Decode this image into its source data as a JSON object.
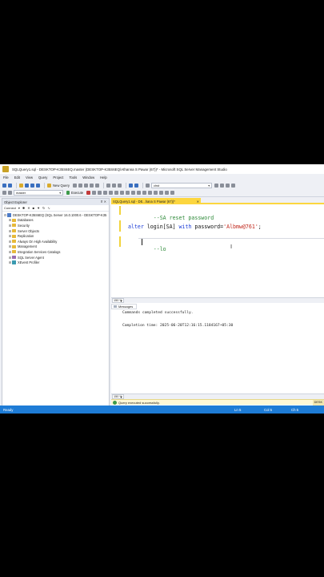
{
  "window": {
    "title": "SQLQuery1.sql - DESKTOP-K35S6EQ.master (DESKTOP-K35S6EQ\\Athanna S Pawar (67))* - Microsoft SQL Server Management Studio"
  },
  "menu": [
    "File",
    "Edit",
    "View",
    "Query",
    "Project",
    "Tools",
    "Window",
    "Help"
  ],
  "toolbar": {
    "new_query_label": "New Query",
    "db_combo_value": "master",
    "execute_label": "Execute",
    "search_combo_value": "chst"
  },
  "object_explorer": {
    "title": "Object Explorer",
    "connect_label": "Connect",
    "server_node": "DESKTOP-K35S6EQ (SQL Server 16.0.1000.6 - DESKTOP-K35",
    "nodes": [
      "Databases",
      "Security",
      "Server Objects",
      "Replication",
      "Always On High Availability",
      "Management",
      "Integration Services Catalogs",
      "SQL Server Agent",
      "XEvent Profiler"
    ]
  },
  "editor": {
    "tab_label": "SQLQuery1.sql - DE...hana S Pawar (67))*",
    "lines": {
      "comment1": "--SA reset password",
      "alter_kw1": "alter",
      "alter_text1": " login[SA] ",
      "alter_kw2": "with",
      "alter_text2": " password=",
      "alter_string": "'Albmw@761'",
      "alter_end": ";",
      "comment2": "--lo"
    },
    "zoom": "150 %"
  },
  "results": {
    "tab_label": "Messages",
    "line1": "Commands completed successfully.",
    "line2": "Completion time: 2025-06-20T12:16:15.1184167+05:30",
    "zoom": "150 %"
  },
  "query_status": {
    "text": "Query executed successfully.",
    "server": "DESK"
  },
  "statusbar": {
    "ready": "Ready",
    "ln": "Ln 5",
    "col": "Col 5",
    "ch": "Ch 5"
  },
  "colors": {
    "accent": "#1e7cd6",
    "tab_active": "#fcd63f",
    "keyword": "#1a3bd6",
    "comment": "#2f8a3a",
    "string": "#c0271b"
  }
}
